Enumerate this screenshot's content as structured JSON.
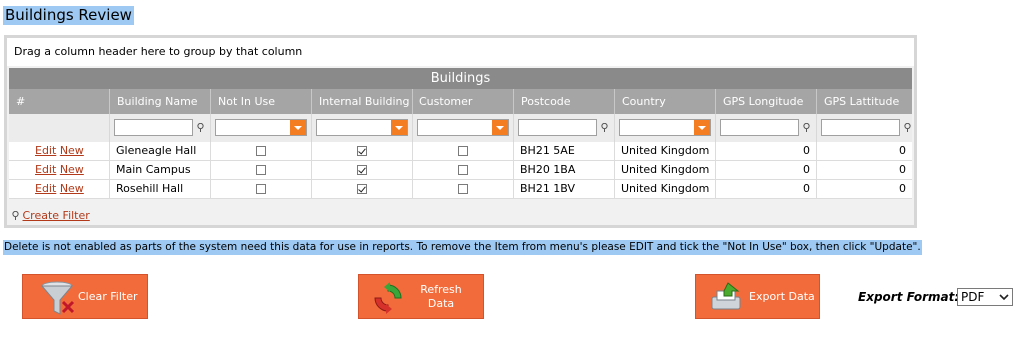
{
  "page_title": "Buildings Review",
  "grid": {
    "group_prompt": "Drag a column header here to group by that column",
    "caption": "Buildings",
    "columns": [
      "#",
      "Building Name",
      "Not In Use",
      "Internal Building",
      "Customer Building",
      "Postcode",
      "Country",
      "GPS Longitude",
      "GPS Lattitude"
    ],
    "rows": [
      {
        "edit": "Edit",
        "new": "New",
        "name": "Gleneagle Hall",
        "not_in_use": false,
        "internal": true,
        "customer": false,
        "postcode": "BH21 5AE",
        "country": "United Kingdom",
        "lon": "0",
        "lat": "0"
      },
      {
        "edit": "Edit",
        "new": "New",
        "name": "Main Campus",
        "not_in_use": false,
        "internal": true,
        "customer": false,
        "postcode": "BH20 1BA",
        "country": "United Kingdom",
        "lon": "0",
        "lat": "0"
      },
      {
        "edit": "Edit",
        "new": "New",
        "name": "Rosehill Hall",
        "not_in_use": false,
        "internal": true,
        "customer": false,
        "postcode": "BH21 1BV",
        "country": "United Kingdom",
        "lon": "0",
        "lat": "0"
      }
    ],
    "create_filter": "Create Filter"
  },
  "notice": "Delete is not enabled as parts of the system need this data for use in reports. To remove the Item from menu's please EDIT and tick the \"Not In Use\" box, then click \"Update\".",
  "buttons": {
    "clear_filter": "Clear Filter",
    "refresh_line1": "Refresh",
    "refresh_line2": "Data",
    "export_data": "Export Data"
  },
  "export": {
    "label": "Export Format:",
    "value": "PDF"
  },
  "icons": [
    "funnel-icon",
    "refresh-icon",
    "export-icon",
    "filter-pin-icon",
    "chevron-down-icon"
  ],
  "colors": {
    "accent": "#f26c3b",
    "header": "#a5a5a5",
    "caption": "#8a8a8a",
    "highlight": "#9ec9f3",
    "link": "#b23a1a"
  }
}
